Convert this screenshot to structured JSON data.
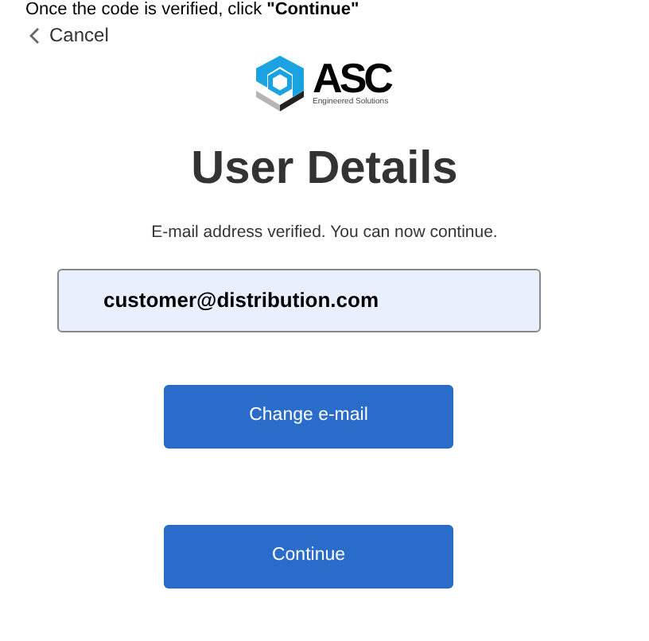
{
  "instruction": "Once the code is verified, click **\"Continue\"**",
  "cancel": {
    "label": "Cancel"
  },
  "logo": {
    "name": "ASC",
    "tagline": "Engineered Solutions"
  },
  "title": "User Details",
  "message": "E-mail address verified. You can now continue.",
  "email_field": {
    "value": "customer@distribution.com"
  },
  "buttons": [
    {
      "label": "Change e-mail"
    },
    {
      "label": "Continue"
    }
  ]
}
